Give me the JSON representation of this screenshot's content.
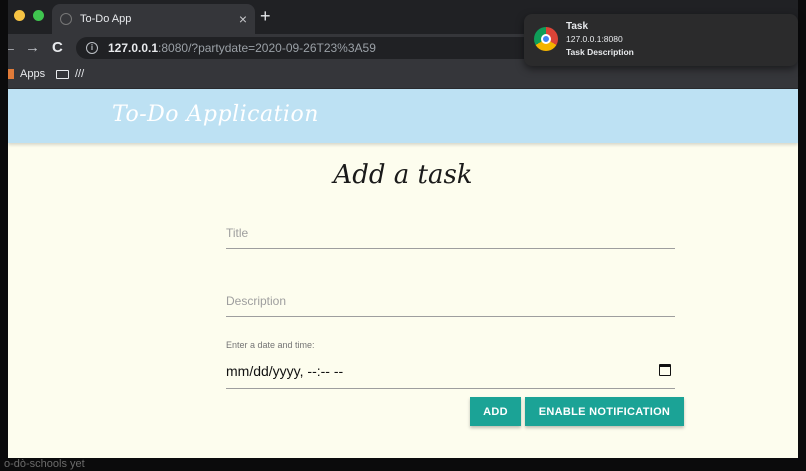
{
  "browser": {
    "tab_title": "To-Do App",
    "tab_close": "×",
    "new_tab": "+",
    "url_host": "127.0.0.1",
    "url_rest": ":8080/?partydate=2020-09-26T23%3A59",
    "bookmarks": {
      "apps": "Apps",
      "folder": "///"
    }
  },
  "notification": {
    "title": "Task",
    "origin": "127.0.0.1:8080",
    "description": "Task Description"
  },
  "app": {
    "brand": "To-Do Application",
    "heading": "Add a task",
    "form": {
      "title_placeholder": "Title",
      "description_placeholder": "Description",
      "datetime_label": "Enter a date and time:",
      "datetime_value": "mm/dd/yyyy, --:-- --"
    },
    "buttons": {
      "add": "ADD",
      "enable_notification": "ENABLE NOTIFICATION"
    },
    "colors": {
      "header": "#bde1f3",
      "page_bg": "#fdfdee",
      "button": "#1ba396"
    }
  },
  "background_text": "o-dò-schools yet"
}
